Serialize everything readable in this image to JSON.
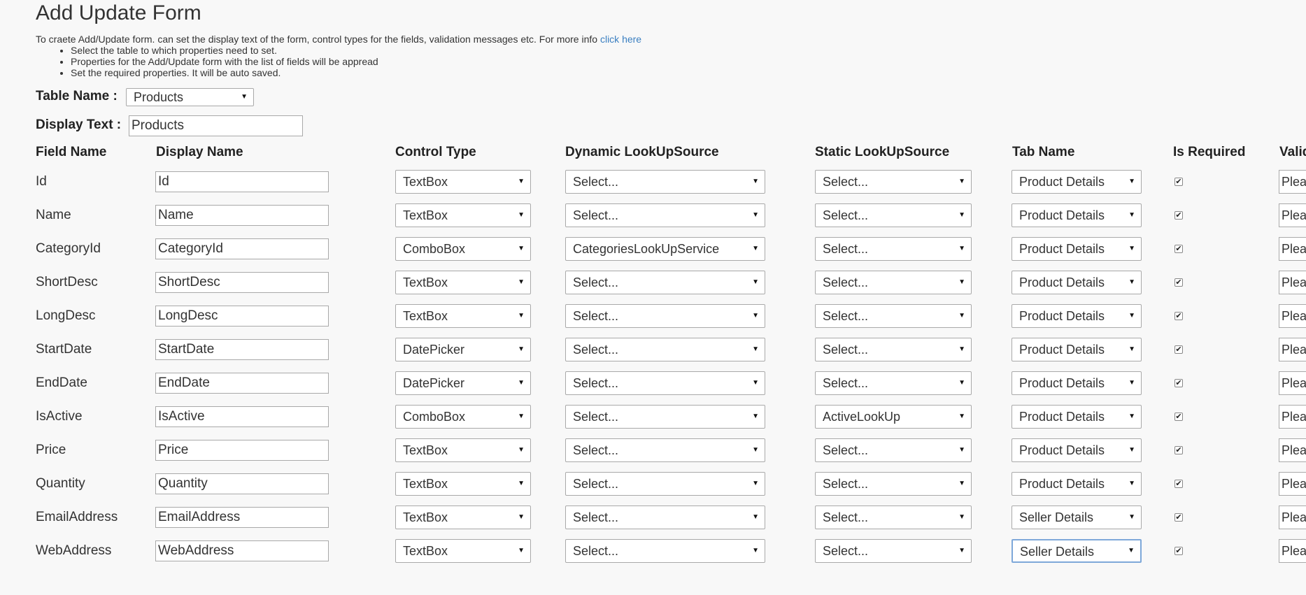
{
  "page": {
    "title": "Add Update Form",
    "intro_text": "To craete Add/Update form. can set the display text of the form, control types for the fields, validation messages etc. For more info",
    "intro_link": "click here",
    "steps": [
      "Select the table to which properties need to set.",
      "Properties for the Add/Update form with the list of fields will be appread",
      "Set the required properties. It will be auto saved."
    ]
  },
  "table_name": {
    "label": "Table Name :",
    "value": "Products"
  },
  "display_text": {
    "label": "Display Text :",
    "value": "Products"
  },
  "columns": {
    "field_name": "Field Name",
    "display_name": "Display Name",
    "control_type": "Control Type",
    "dynamic_lookup": "Dynamic LookUpSource",
    "static_lookup": "Static LookUpSource",
    "tab_name": "Tab Name",
    "is_required": "Is Required",
    "validation": "Valid"
  },
  "rows": [
    {
      "field": "Id",
      "display": "Id",
      "control": "TextBox",
      "dynamic": "Select...",
      "static": "Select...",
      "tab": "Product Details",
      "required": "✔",
      "validation": "Plea"
    },
    {
      "field": "Name",
      "display": "Name",
      "control": "TextBox",
      "dynamic": "Select...",
      "static": "Select...",
      "tab": "Product Details",
      "required": "✔",
      "validation": "Plea"
    },
    {
      "field": "CategoryId",
      "display": "CategoryId",
      "control": "ComboBox",
      "dynamic": "CategoriesLookUpService",
      "static": "Select...",
      "tab": "Product Details",
      "required": "✔",
      "validation": "Plea"
    },
    {
      "field": "ShortDesc",
      "display": "ShortDesc",
      "control": "TextBox",
      "dynamic": "Select...",
      "static": "Select...",
      "tab": "Product Details",
      "required": "✔",
      "validation": "Plea"
    },
    {
      "field": "LongDesc",
      "display": "LongDesc",
      "control": "TextBox",
      "dynamic": "Select...",
      "static": "Select...",
      "tab": "Product Details",
      "required": "✔",
      "validation": "Plea"
    },
    {
      "field": "StartDate",
      "display": "StartDate",
      "control": "DatePicker",
      "dynamic": "Select...",
      "static": "Select...",
      "tab": "Product Details",
      "required": "✔",
      "validation": "Plea"
    },
    {
      "field": "EndDate",
      "display": "EndDate",
      "control": "DatePicker",
      "dynamic": "Select...",
      "static": "Select...",
      "tab": "Product Details",
      "required": "✔",
      "validation": "Plea"
    },
    {
      "field": "IsActive",
      "display": "IsActive",
      "control": "ComboBox",
      "dynamic": "Select...",
      "static": "ActiveLookUp",
      "tab": "Product Details",
      "required": "✔",
      "validation": "Plea"
    },
    {
      "field": "Price",
      "display": "Price",
      "control": "TextBox",
      "dynamic": "Select...",
      "static": "Select...",
      "tab": "Product Details",
      "required": "✔",
      "validation": "Plea"
    },
    {
      "field": "Quantity",
      "display": "Quantity",
      "control": "TextBox",
      "dynamic": "Select...",
      "static": "Select...",
      "tab": "Product Details",
      "required": "✔",
      "validation": "Plea"
    },
    {
      "field": "EmailAddress",
      "display": "EmailAddress",
      "control": "TextBox",
      "dynamic": "Select...",
      "static": "Select...",
      "tab": "Seller Details",
      "required": "✔",
      "validation": "Plea"
    },
    {
      "field": "WebAddress",
      "display": "WebAddress",
      "control": "TextBox",
      "dynamic": "Select...",
      "static": "Select...",
      "tab": "Seller Details",
      "required": "✔",
      "validation": "Plea"
    }
  ],
  "focused_tab_row": 11,
  "icons": {
    "dropdown": "caret-down-icon",
    "check": "checkmark-icon"
  }
}
